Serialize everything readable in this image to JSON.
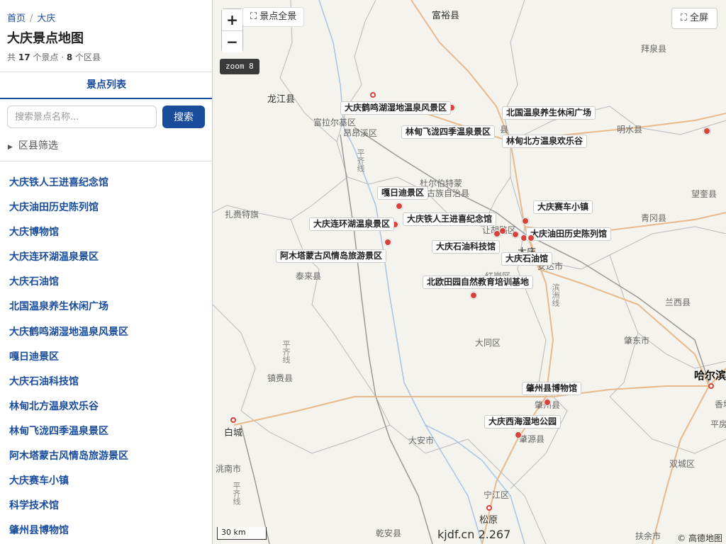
{
  "breadcrumb": {
    "home": "首页",
    "separator": "/",
    "current": "大庆"
  },
  "page_title": "大庆景点地图",
  "stats": {
    "prefix": "共",
    "spot_count": "17",
    "spot_unit": "个景点 ·",
    "district_count": "8",
    "district_unit": "个区县"
  },
  "tab_label": "景点列表",
  "search": {
    "placeholder": "搜索景点名称...",
    "button": "搜索"
  },
  "filter_label": "区县筛选",
  "attractions": [
    "大庆铁人王进喜纪念馆",
    "大庆油田历史陈列馆",
    "大庆博物馆",
    "大庆连环湖温泉景区",
    "大庆石油馆",
    "北国温泉养生休闲广场",
    "大庆鹤鸣湖湿地温泉风景区",
    "嘎日迪景区",
    "大庆石油科技馆",
    "林甸北方温泉欢乐谷",
    "林甸飞泷四季温泉景区",
    "阿木塔蒙古风情岛旅游景区",
    "大庆赛车小镇",
    "科学技术馆",
    "肇州县博物馆"
  ],
  "map": {
    "zoom_in": "+",
    "zoom_out": "−",
    "overview_label": "景点全景",
    "fullscreen_label": "全屏",
    "zoom_badge": "zoom 8",
    "scale_label": "30 km",
    "watermark": "kjdf.cn 2.267",
    "attribution": "© 高德地图",
    "colors": {
      "marker": "#d9413a",
      "accent": "#1a4c9c",
      "road": "#e9b98a"
    },
    "markers": [
      {
        "name": "大庆鹤鸣湖湿地温泉风景区"
      },
      {
        "name": "北国温泉养生休闲广场"
      },
      {
        "name": "林甸飞泷四季温泉景区"
      },
      {
        "name": "林甸北方温泉欢乐谷"
      },
      {
        "name": "嘎日迪景区"
      },
      {
        "name": "大庆赛车小镇"
      },
      {
        "name": "大庆铁人王进喜纪念馆"
      },
      {
        "name": "大庆连环湖温泉景区"
      },
      {
        "name": "大庆油田历史陈列馆"
      },
      {
        "name": "大庆石油科技馆"
      },
      {
        "name": "阿木塔蒙古风情岛旅游景区"
      },
      {
        "name": "大庆石油馆"
      },
      {
        "name": "北欧田园自然教育培训基地"
      },
      {
        "name": "肇州县博物馆"
      },
      {
        "name": "大庆西海湿地公园"
      }
    ],
    "places": [
      "富裕县",
      "拜泉县",
      "龙江县",
      "富拉尔基区",
      "昂昂溪区",
      "明水县",
      "杜尔伯特蒙",
      "古族自治县",
      "扎赉特旗",
      "青冈县",
      "望奎县",
      "让胡路区",
      "大庆",
      "安达市",
      "红岗区",
      "泰来县",
      "兰西县",
      "肇东市",
      "大同区",
      "哈尔滨",
      "镇赉县",
      "肇州县",
      "白城",
      "肇源县",
      "大安市",
      "洮南市",
      "双城区",
      "宁江区",
      "松原",
      "乾安县",
      "扶余市",
      "香坊",
      "平房",
      "县",
      "平齐线",
      "平齐线",
      "滨洲线",
      "平齐线"
    ]
  }
}
